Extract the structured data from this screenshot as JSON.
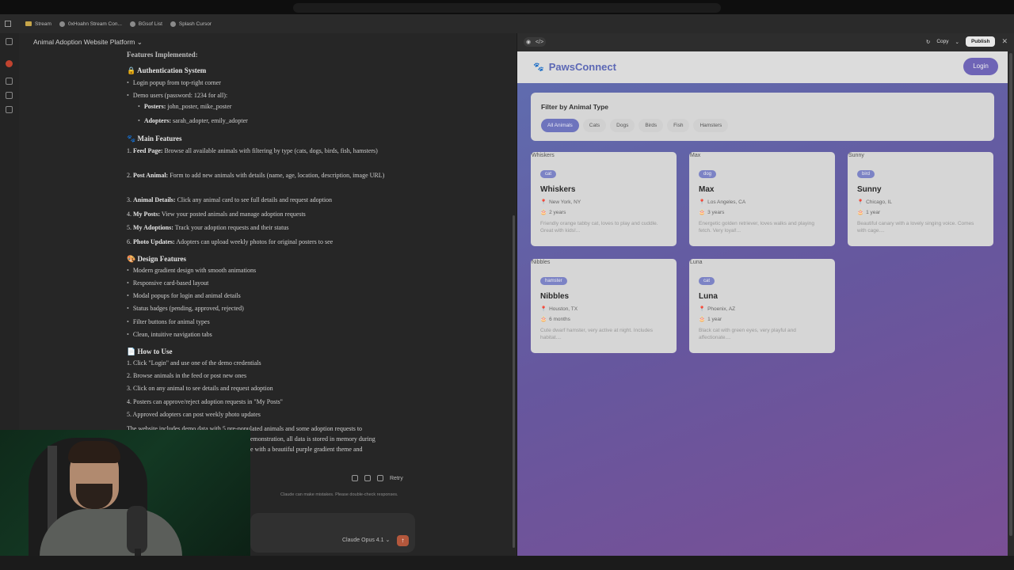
{
  "bookmarks": [
    "Stream",
    "0xHoahn Stream Con...",
    "BGsof List",
    "Splash Cursor"
  ],
  "chat": {
    "title": "Animal Adoption Website Platform ⌄",
    "features_heading": "Features Implemented:",
    "auth": {
      "heading": "🔒 Authentication System",
      "b1": "Login popup from top-right corner",
      "b2": "Demo users (password: 1234 for all):",
      "posters_label": "Posters:",
      "posters_value": " john_poster, mike_poster",
      "adopters_label": "Adopters:",
      "adopters_value": " sarah_adopter, emily_adopter"
    },
    "main": {
      "heading": "🐾 Main Features",
      "i1_label": "Feed Page:",
      "i1_text": " Browse all available animals with filtering by type (cats, dogs, birds, fish, hamsters)",
      "i2_label": "Post Animal:",
      "i2_text": " Form to add new animals with details (name, age, location, description, image URL)",
      "i3_label": "Animal Details:",
      "i3_text": " Click any animal card to see full details and request adoption",
      "i4_label": "My Posts:",
      "i4_text": " View your posted animals and manage adoption requests",
      "i5_label": "My Adoptions:",
      "i5_text": " Track your adoption requests and their status",
      "i6_label": "Photo Updates:",
      "i6_text": " Adopters can upload weekly photos for original posters to see"
    },
    "design": {
      "heading": "🎨 Design Features",
      "b1": "Modern gradient design with smooth animations",
      "b2": "Responsive card-based layout",
      "b3": "Modal popups for login and animal details",
      "b4": "Status badges (pending, approved, rejected)",
      "b5": "Filter buttons for animal types",
      "b6": "Clean, intuitive navigation tabs"
    },
    "howto": {
      "heading": "📄 How to Use",
      "s1": "1. Click \"Login\" and use one of the demo credentials",
      "s2": "2. Browse animals in the feed or post new ones",
      "s3": "3. Click on any animal to see details and request adoption",
      "s4": "4. Posters can approve/reject adoption requests in \"My Posts\"",
      "s5": "5. Approved adopters can post weekly photo updates"
    },
    "footer_p1": "The website includes demo data with 5 pre-populated animals and some adoption requests to",
    "footer_p2": "emonstration, all data is stored in memory during",
    "footer_p3": "e with a beautiful purple gradient theme and",
    "retry": "Retry",
    "disclaimer": "Claude can make mistakes. Please double-check responses.",
    "model": "Claude Opus 4.1 ⌄"
  },
  "preview_toolbar": {
    "copy": "Copy",
    "publish": "Publish"
  },
  "site": {
    "logo": "PawsConnect",
    "login": "Login",
    "filter_title": "Filter by Animal Type",
    "filters": [
      "All Animals",
      "Cats",
      "Dogs",
      "Birds",
      "Fish",
      "Hamsters"
    ],
    "animals": [
      {
        "alt": "Whiskers",
        "type": "cat",
        "name": "Whiskers",
        "location": "New York, NY",
        "age": "2 years",
        "desc": "Friendly orange tabby cat, loves to play and cuddle. Great with kids!..."
      },
      {
        "alt": "Max",
        "type": "dog",
        "name": "Max",
        "location": "Los Angeles, CA",
        "age": "3 years",
        "desc": "Energetic golden retriever, loves walks and playing fetch. Very loyal!..."
      },
      {
        "alt": "Sunny",
        "type": "bird",
        "name": "Sunny",
        "location": "Chicago, IL",
        "age": "1 year",
        "desc": "Beautiful canary with a lovely singing voice. Comes with cage...."
      },
      {
        "alt": "Nibbles",
        "type": "hamster",
        "name": "Nibbles",
        "location": "Houston, TX",
        "age": "6 months",
        "desc": "Cute dwarf hamster, very active at night. Includes habitat...."
      },
      {
        "alt": "Luna",
        "type": "cat",
        "name": "Luna",
        "location": "Phoenix, AZ",
        "age": "1 year",
        "desc": "Black cat with green eyes, very playful and affectionate...."
      }
    ]
  }
}
